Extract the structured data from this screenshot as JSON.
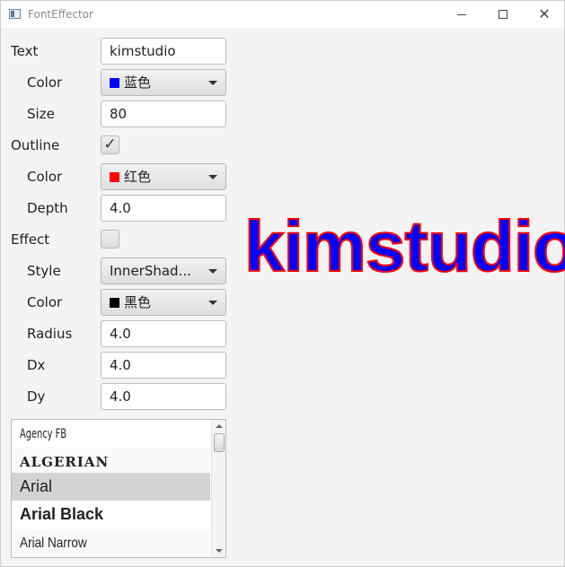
{
  "window": {
    "title": "FontEffector",
    "icons": {
      "app": "app-window-icon",
      "minimize": "minimize-icon",
      "maximize": "maximize-icon",
      "close": "close-icon"
    }
  },
  "form": {
    "text_label": "Text",
    "text_value": "kimstudio",
    "text_color_label": "Color",
    "text_color_value": "蓝色",
    "text_color_swatch": "#0000ff",
    "size_label": "Size",
    "size_value": "80",
    "outline_label": "Outline",
    "outline_checked": true,
    "outline_check_glyph": "✓",
    "outline_color_label": "Color",
    "outline_color_value": "红色",
    "outline_color_swatch": "#ff0000",
    "depth_label": "Depth",
    "depth_value": "4.0",
    "effect_label": "Effect",
    "effect_checked": false,
    "style_label": "Style",
    "style_value": "InnerShad...",
    "effect_color_label": "Color",
    "effect_color_value": "黑色",
    "effect_color_swatch": "#000000",
    "radius_label": "Radius",
    "radius_value": "4.0",
    "dx_label": "Dx",
    "dx_value": "4.0",
    "dy_label": "Dy",
    "dy_value": "4.0"
  },
  "preview": {
    "text": "kimstudio",
    "fill_color": "#0000ff",
    "outline_color": "#ff0000"
  },
  "font_list": {
    "items": [
      "Agency FB",
      "ALGERIAN",
      "Arial",
      "Arial Black",
      "Arial Narrow"
    ],
    "selected": "Arial"
  }
}
